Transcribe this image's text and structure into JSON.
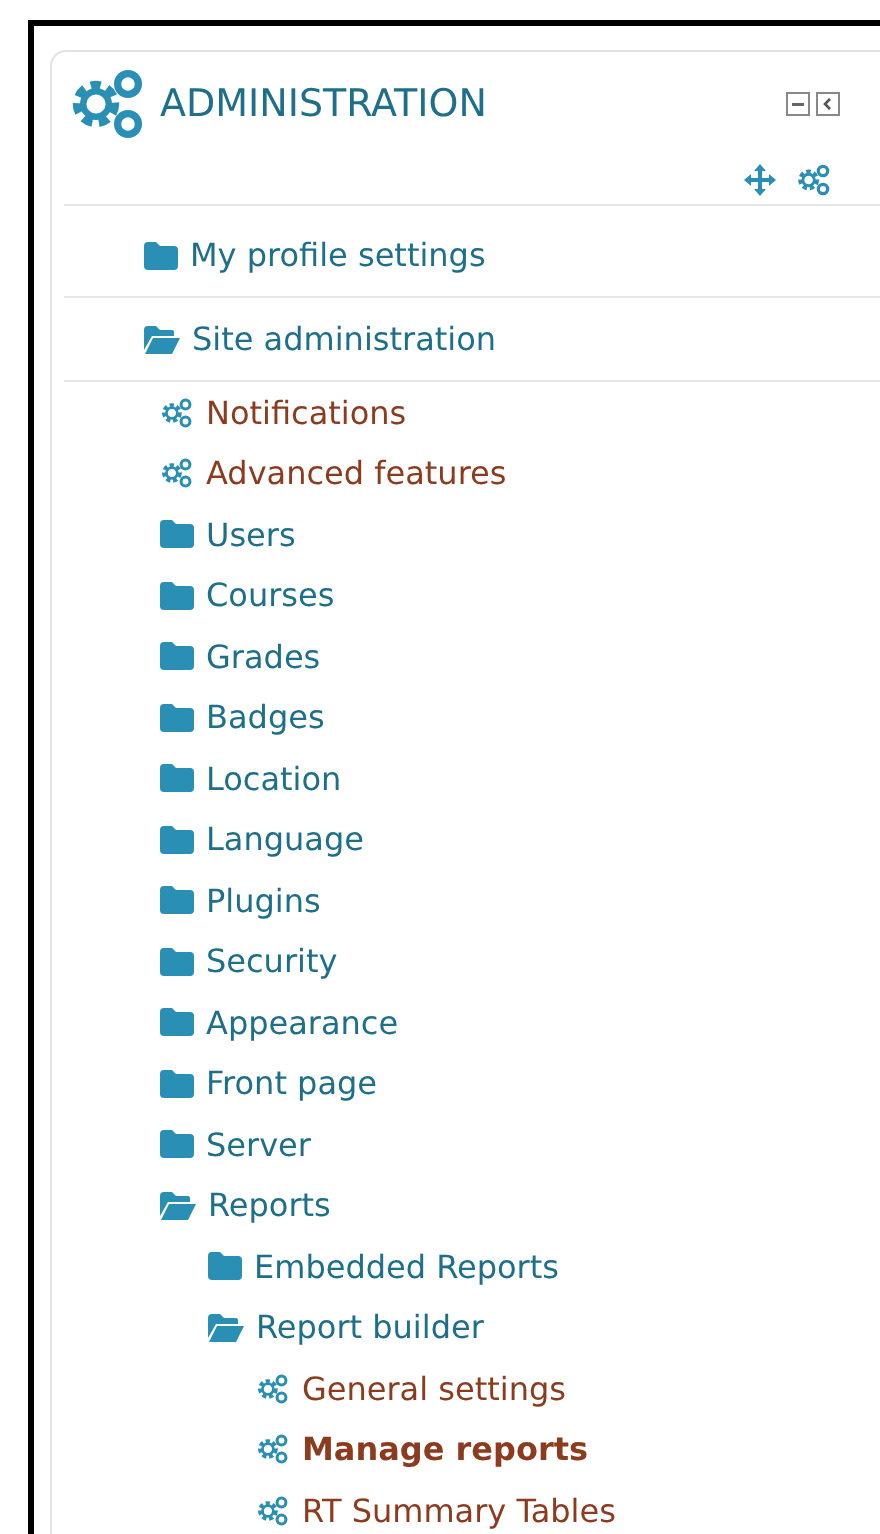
{
  "block": {
    "title": "ADMINISTRATION"
  },
  "sections": [
    {
      "kind": "folder",
      "label": "My profile settings",
      "expanded": false
    },
    {
      "kind": "folder",
      "label": "Site administration",
      "expanded": true,
      "children": [
        {
          "kind": "setting",
          "label": "Notifications",
          "selected": false
        },
        {
          "kind": "setting",
          "label": "Advanced features",
          "selected": false
        },
        {
          "kind": "folder",
          "label": "Users",
          "expanded": false
        },
        {
          "kind": "folder",
          "label": "Courses",
          "expanded": false
        },
        {
          "kind": "folder",
          "label": "Grades",
          "expanded": false
        },
        {
          "kind": "folder",
          "label": "Badges",
          "expanded": false
        },
        {
          "kind": "folder",
          "label": "Location",
          "expanded": false
        },
        {
          "kind": "folder",
          "label": "Language",
          "expanded": false
        },
        {
          "kind": "folder",
          "label": "Plugins",
          "expanded": false
        },
        {
          "kind": "folder",
          "label": "Security",
          "expanded": false
        },
        {
          "kind": "folder",
          "label": "Appearance",
          "expanded": false
        },
        {
          "kind": "folder",
          "label": "Front page",
          "expanded": false
        },
        {
          "kind": "folder",
          "label": "Server",
          "expanded": false
        },
        {
          "kind": "folder",
          "label": "Reports",
          "expanded": true,
          "children": [
            {
              "kind": "folder",
              "label": "Embedded Reports",
              "expanded": false
            },
            {
              "kind": "folder",
              "label": "Report builder",
              "expanded": true,
              "children": [
                {
                  "kind": "setting",
                  "label": "General settings",
                  "selected": false
                },
                {
                  "kind": "setting",
                  "label": "Manage reports",
                  "selected": true
                },
                {
                  "kind": "setting",
                  "label": "RT Summary Tables",
                  "selected": false
                }
              ]
            }
          ]
        }
      ]
    }
  ]
}
